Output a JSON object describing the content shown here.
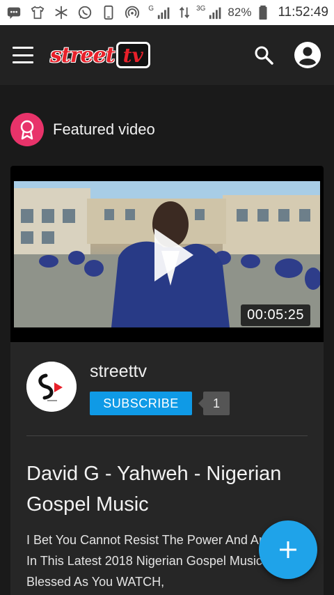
{
  "status_bar": {
    "battery": "82%",
    "time": "11:52:49",
    "network": "3G",
    "network2": "G"
  },
  "app_bar": {
    "logo_street": "street",
    "logo_tv": "tv"
  },
  "featured": {
    "label": "Featured video"
  },
  "video": {
    "duration": "00:05:25"
  },
  "channel": {
    "name": "streettv",
    "subscribe_label": "SUBSCRIBE",
    "subscriber_count": "1"
  },
  "post": {
    "title": "David G - Yahweh - Nigerian Gospel Music",
    "description": "I Bet You Cannot Resist The Power And Anointing In This Latest 2018 Nigerian Gospel Music! Be Blessed As You WATCH,"
  },
  "colors": {
    "accent_blue": "#0f9ae6",
    "fab_blue": "#1fa3e9",
    "badge_pink": "#e8336a",
    "logo_red": "#e8202a"
  },
  "icons": [
    "message-icon",
    "tshirt-icon",
    "snowflake-icon",
    "whatsapp-icon",
    "phone-icon",
    "hotspot-icon",
    "signal-icon",
    "data-arrows-icon",
    "battery-icon",
    "menu-icon",
    "search-icon",
    "account-icon",
    "ribbon-icon",
    "play-icon",
    "plus-icon"
  ]
}
